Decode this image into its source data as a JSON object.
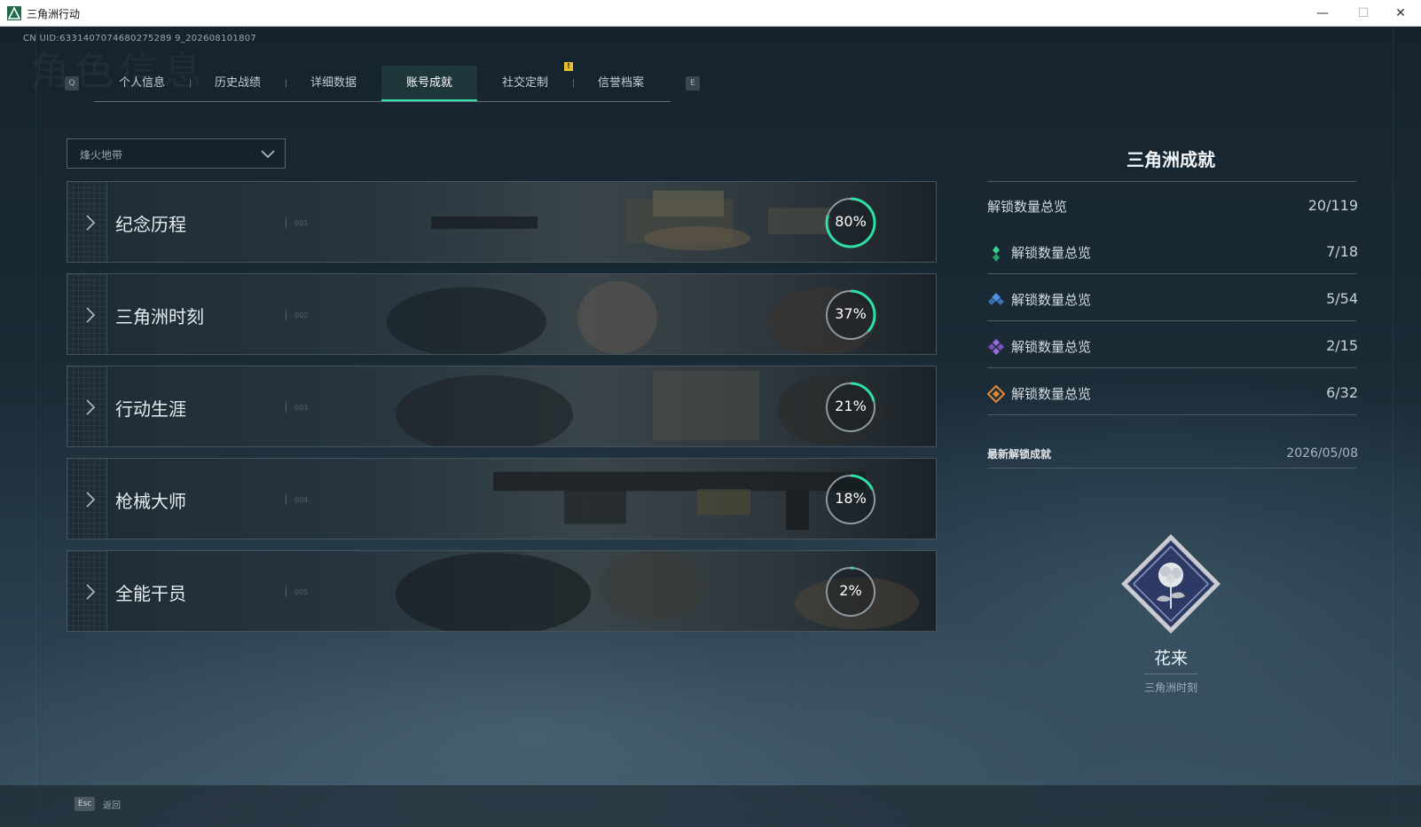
{
  "window": {
    "title": "三角洲行动",
    "minimize": "—",
    "maximize": "☐",
    "close": "✕"
  },
  "header": {
    "uid": "CN UID:6331407074680275289 9_202608101807",
    "watermark": "角色信息"
  },
  "tabs": {
    "left_key": "Q",
    "right_key": "E",
    "notice": "!",
    "items": [
      {
        "label": "个人信息"
      },
      {
        "label": "历史战绩"
      },
      {
        "label": "详细数据"
      },
      {
        "label": "账号成就",
        "active": true
      },
      {
        "label": "社交定制"
      },
      {
        "label": "信誉档案"
      }
    ]
  },
  "filter": {
    "selected": "烽火地带"
  },
  "categories": [
    {
      "label": "纪念历程",
      "code": "001",
      "progress": 0.8,
      "progress_text": "80%"
    },
    {
      "label": "三角洲时刻",
      "code": "002",
      "progress": 0.37,
      "progress_text": "37%"
    },
    {
      "label": "行动生涯",
      "code": "003",
      "progress": 0.21,
      "progress_text": "21%"
    },
    {
      "label": "枪械大师",
      "code": "004",
      "progress": 0.18,
      "progress_text": "18%"
    },
    {
      "label": "全能干员",
      "code": "005",
      "progress": 0.02,
      "progress_text": "2%"
    }
  ],
  "right_panel": {
    "title": "三角洲成就",
    "overview_label": "解锁数量总览",
    "overview_value": "20/119",
    "rows": [
      {
        "icon": "green-diamond-icon",
        "color": "#3ad48e",
        "label": "解锁数量总览",
        "value": "7/18"
      },
      {
        "icon": "blue-diamond-icon",
        "color": "#4a8fe0",
        "label": "解锁数量总览",
        "value": "5/54"
      },
      {
        "icon": "purple-diamond-icon",
        "color": "#9b6ae0",
        "label": "解锁数量总览",
        "value": "2/15"
      },
      {
        "icon": "orange-diamond-icon",
        "color": "#e0893a",
        "label": "解锁数量总览",
        "value": "6/32"
      }
    ],
    "latest_label": "最新解锁成就",
    "latest_date": "2026/05/08",
    "latest_name": "花来",
    "latest_category": "三角洲时刻"
  },
  "footer": {
    "esc_key": "Esc",
    "esc_label": "返回"
  },
  "colors": {
    "accent": "#2fe0a5",
    "ring_track": "#8e9aa2"
  }
}
